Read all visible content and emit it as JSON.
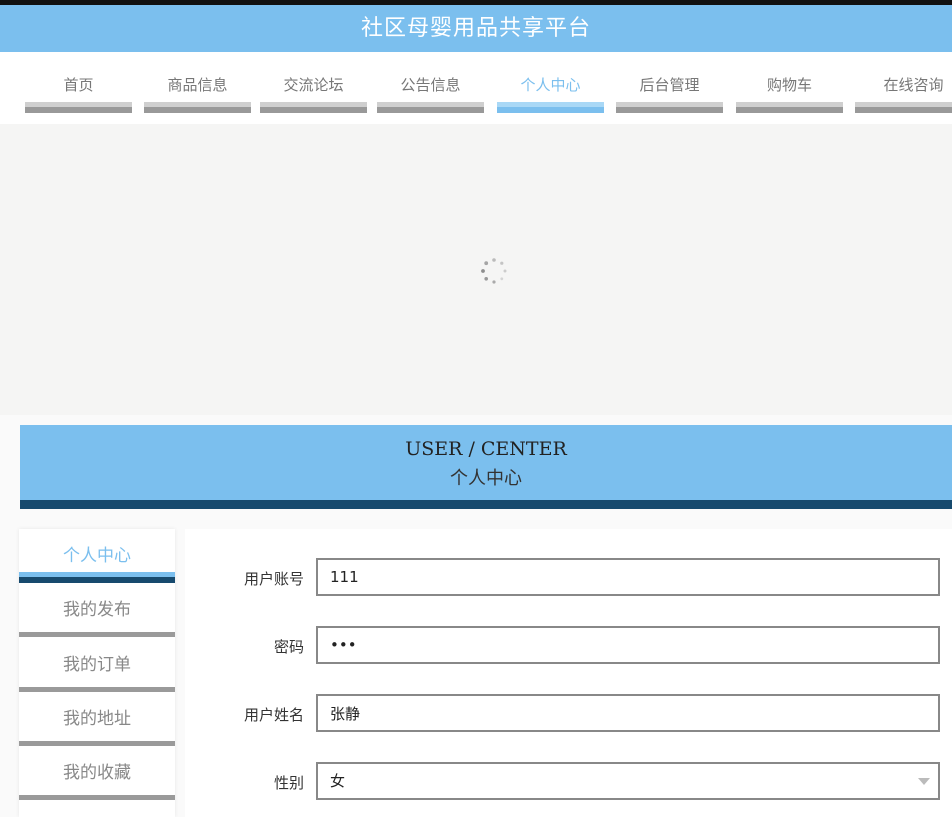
{
  "header": {
    "title": "社区母婴用品共享平台"
  },
  "nav": {
    "items": [
      {
        "label": "首页"
      },
      {
        "label": "商品信息"
      },
      {
        "label": "交流论坛"
      },
      {
        "label": "公告信息"
      },
      {
        "label": "个人中心",
        "active": true
      },
      {
        "label": "后台管理"
      },
      {
        "label": "购物车"
      },
      {
        "label": "在线咨询"
      }
    ]
  },
  "banner": {
    "state": "loading",
    "icon": "spinner-icon"
  },
  "section": {
    "title_en": "USER / CENTER",
    "title_cn": "个人中心"
  },
  "sidebar": {
    "items": [
      {
        "label": "个人中心",
        "active": true
      },
      {
        "label": "我的发布"
      },
      {
        "label": "我的订单"
      },
      {
        "label": "我的地址"
      },
      {
        "label": "我的收藏"
      }
    ]
  },
  "form": {
    "account_label": "用户账号",
    "account_value": "111",
    "password_label": "密码",
    "password_value": "•••",
    "name_label": "用户姓名",
    "name_value": "张静",
    "gender_label": "性别",
    "gender_value": "女"
  },
  "colors": {
    "accent": "#7bbfee",
    "dark": "#174a6e",
    "inactive_bar": "#999999"
  }
}
